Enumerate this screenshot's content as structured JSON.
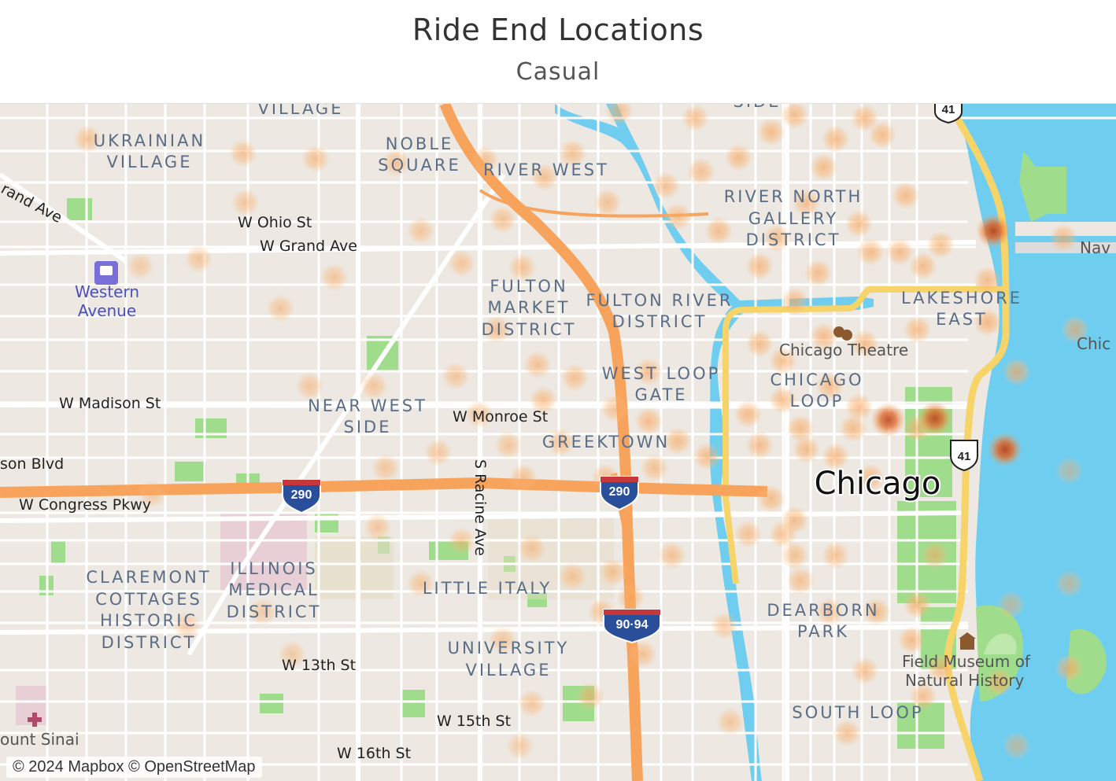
{
  "header": {
    "title": "Ride End Locations",
    "subtitle": "Casual"
  },
  "map": {
    "neighborhoods": [
      {
        "lines": [
          "UKRAINIAN",
          "VILLAGE"
        ]
      },
      {
        "lines": [
          "NOBLE",
          "SQUARE"
        ]
      },
      {
        "lines": [
          "RIVER WEST"
        ]
      },
      {
        "lines": [
          "RIVER NORTH",
          "GALLERY",
          "DISTRICT"
        ]
      },
      {
        "lines": [
          "FULTON",
          "MARKET",
          "DISTRICT"
        ]
      },
      {
        "lines": [
          "FULTON RIVER",
          "DISTRICT"
        ]
      },
      {
        "lines": [
          "LAKESHORE",
          "EAST"
        ]
      },
      {
        "lines": [
          "WEST LOOP",
          "GATE"
        ]
      },
      {
        "lines": [
          "CHICAGO",
          "LOOP"
        ]
      },
      {
        "lines": [
          "NEAR WEST",
          "SIDE"
        ]
      },
      {
        "lines": [
          "GREEKTOWN"
        ]
      },
      {
        "lines": [
          "CLAREMONT",
          "COTTAGES",
          "HISTORIC",
          "DISTRICT"
        ]
      },
      {
        "lines": [
          "ILLINOIS",
          "MEDICAL",
          "DISTRICT"
        ]
      },
      {
        "lines": [
          "LITTLE ITALY"
        ]
      },
      {
        "lines": [
          "DEARBORN",
          "PARK"
        ]
      },
      {
        "lines": [
          "UNIVERSITY",
          "VILLAGE"
        ]
      },
      {
        "lines": [
          "SOUTH LOOP"
        ]
      },
      {
        "lines": [
          "VILLAGE"
        ]
      },
      {
        "lines": [
          "SIDE"
        ]
      }
    ],
    "streets": [
      "W Ohio St",
      "W Grand Ave",
      "W Madison St",
      "W Monroe St",
      "W Congress Pkwy",
      "S Racine Ave",
      "W 13th St",
      "W 15th St",
      "W 16th St",
      "rand Ave",
      "son Blvd"
    ],
    "pois": [
      "Western",
      "Avenue",
      "Chicago Theatre",
      "Field Museum of",
      "Natural History",
      "ount Sinai",
      "Nav",
      "Chic"
    ],
    "city_label": "Chicago",
    "shields": [
      "290",
      "290",
      "90·94",
      "41",
      "41"
    ],
    "attribution": "© 2024 Mapbox © OpenStreetMap",
    "colors": {
      "water": "#6fcdf0",
      "land": "#ede8e2",
      "park": "#9fdc8c",
      "highway": "#f7a35c",
      "primary": "#f7d46a",
      "hotspot": "#f9a55c",
      "hotspot_hot": "#b8471f",
      "label": "#5a6d86"
    },
    "heatmap_points": [
      {
        "lat": 41.8995,
        "lon": -87.6875,
        "w": 0.5
      },
      {
        "lat": 41.8985,
        "lon": -87.6742,
        "w": 0.5
      },
      {
        "lat": 41.8981,
        "lon": -87.668,
        "w": 0.5
      },
      {
        "lat": 41.8978,
        "lon": -87.6611,
        "w": 0.5
      },
      {
        "lat": 41.898,
        "lon": -87.6535,
        "w": 0.5
      },
      {
        "lat": 41.8968,
        "lon": -87.6484,
        "w": 0.5
      },
      {
        "lat": 41.8938,
        "lon": -87.652,
        "w": 0.5
      },
      {
        "lat": 41.893,
        "lon": -87.659,
        "w": 0.4
      },
      {
        "lat": 41.8897,
        "lon": -87.6664,
        "w": 0.4
      },
      {
        "lat": 41.8907,
        "lon": -87.6555,
        "w": 0.4
      },
      {
        "lat": 41.8904,
        "lon": -87.6503,
        "w": 0.5
      },
      {
        "lat": 41.886,
        "lon": -87.6525,
        "w": 0.5
      },
      {
        "lat": 41.8827,
        "lon": -87.656,
        "w": 0.4
      },
      {
        "lat": 41.8835,
        "lon": -87.649,
        "w": 0.5
      },
      {
        "lat": 41.881,
        "lon": -87.6485,
        "w": 0.5
      },
      {
        "lat": 41.8826,
        "lon": -87.6458,
        "w": 0.5
      },
      {
        "lat": 41.88,
        "lon": -87.654,
        "w": 0.4
      },
      {
        "lat": 41.8778,
        "lon": -87.6515,
        "w": 0.4
      },
      {
        "lat": 41.8755,
        "lon": -87.6502,
        "w": 0.5
      },
      {
        "lat": 41.8755,
        "lon": -87.6432,
        "w": 0.5
      },
      {
        "lat": 41.878,
        "lon": -87.647,
        "w": 0.5
      },
      {
        "lat": 41.8804,
        "lon": -87.6424,
        "w": 0.5
      },
      {
        "lat": 41.883,
        "lon": -87.6395,
        "w": 0.6
      },
      {
        "lat": 41.8781,
        "lon": -87.637,
        "w": 0.6
      },
      {
        "lat": 41.8795,
        "lon": -87.6395,
        "w": 0.6
      },
      {
        "lat": 41.8762,
        "lon": -87.639,
        "w": 0.5
      },
      {
        "lat": 41.877,
        "lon": -87.6345,
        "w": 0.6
      },
      {
        "lat": 41.88,
        "lon": -87.631,
        "w": 0.6
      },
      {
        "lat": 41.881,
        "lon": -87.628,
        "w": 0.6
      },
      {
        "lat": 41.885,
        "lon": -87.63,
        "w": 0.6
      },
      {
        "lat": 41.888,
        "lon": -87.627,
        "w": 0.6
      },
      {
        "lat": 41.89,
        "lon": -87.625,
        "w": 0.6
      },
      {
        "lat": 41.8905,
        "lon": -87.63,
        "w": 0.6
      },
      {
        "lat": 41.8925,
        "lon": -87.6285,
        "w": 0.6
      },
      {
        "lat": 41.893,
        "lon": -87.6335,
        "w": 0.6
      },
      {
        "lat": 41.895,
        "lon": -87.626,
        "w": 0.6
      },
      {
        "lat": 41.8975,
        "lon": -87.6245,
        "w": 0.6
      },
      {
        "lat": 41.8982,
        "lon": -87.6318,
        "w": 0.6
      },
      {
        "lat": 41.9,
        "lon": -87.629,
        "w": 0.6
      },
      {
        "lat": 41.9012,
        "lon": -87.627,
        "w": 0.6
      },
      {
        "lat": 41.8995,
        "lon": -87.6235,
        "w": 0.6
      },
      {
        "lat": 41.8998,
        "lon": -87.6195,
        "w": 0.6
      },
      {
        "lat": 41.901,
        "lon": -87.621,
        "w": 0.6
      },
      {
        "lat": 41.8955,
        "lon": -87.6175,
        "w": 0.6
      },
      {
        "lat": 41.8935,
        "lon": -87.6215,
        "w": 0.6
      },
      {
        "lat": 41.8915,
        "lon": -87.6205,
        "w": 0.6
      },
      {
        "lat": 41.8905,
        "lon": -87.616,
        "w": 0.6
      },
      {
        "lat": 41.892,
        "lon": -87.6145,
        "w": 0.6
      },
      {
        "lat": 41.8915,
        "lon": -87.618,
        "w": 0.6
      },
      {
        "lat": 41.893,
        "lon": -87.61,
        "w": 0.9
      },
      {
        "lat": 41.8895,
        "lon": -87.6105,
        "w": 0.6
      },
      {
        "lat": 41.8865,
        "lon": -87.6105,
        "w": 0.7
      },
      {
        "lat": 41.886,
        "lon": -87.6165,
        "w": 0.6
      },
      {
        "lat": 41.885,
        "lon": -87.621,
        "w": 0.6
      },
      {
        "lat": 41.8855,
        "lon": -87.6245,
        "w": 0.6
      },
      {
        "lat": 41.8838,
        "lon": -87.628,
        "w": 0.6
      },
      {
        "lat": 41.882,
        "lon": -87.624,
        "w": 0.6
      },
      {
        "lat": 41.8805,
        "lon": -87.6215,
        "w": 0.6
      },
      {
        "lat": 41.879,
        "lon": -87.622,
        "w": 0.6
      },
      {
        "lat": 41.879,
        "lon": -87.6265,
        "w": 0.6
      },
      {
        "lat": 41.8778,
        "lon": -87.63,
        "w": 0.6
      },
      {
        "lat": 41.8775,
        "lon": -87.626,
        "w": 0.6
      },
      {
        "lat": 41.877,
        "lon": -87.6235,
        "w": 0.6
      },
      {
        "lat": 41.879,
        "lon": -87.6165,
        "w": 0.6
      },
      {
        "lat": 41.8796,
        "lon": -87.619,
        "w": 0.8
      },
      {
        "lat": 41.8797,
        "lon": -87.615,
        "w": 0.8
      },
      {
        "lat": 41.8755,
        "lon": -87.6205,
        "w": 0.6
      },
      {
        "lat": 41.874,
        "lon": -87.629,
        "w": 0.6
      },
      {
        "lat": 41.8725,
        "lon": -87.627,
        "w": 0.6
      },
      {
        "lat": 41.8715,
        "lon": -87.631,
        "w": 0.5
      },
      {
        "lat": 41.8715,
        "lon": -87.628,
        "w": 0.5
      },
      {
        "lat": 41.87,
        "lon": -87.627,
        "w": 0.5
      },
      {
        "lat": 41.87,
        "lon": -87.6235,
        "w": 0.5
      },
      {
        "lat": 41.8682,
        "lon": -87.6265,
        "w": 0.5
      },
      {
        "lat": 41.866,
        "lon": -87.624,
        "w": 0.5
      },
      {
        "lat": 41.866,
        "lon": -87.62,
        "w": 0.6
      },
      {
        "lat": 41.8665,
        "lon": -87.6165,
        "w": 0.7
      },
      {
        "lat": 41.864,
        "lon": -87.617,
        "w": 0.6
      },
      {
        "lat": 41.8618,
        "lon": -87.621,
        "w": 0.5
      },
      {
        "lat": 41.86,
        "lon": -87.616,
        "w": 0.5
      },
      {
        "lat": 41.8574,
        "lon": -87.6225,
        "w": 0.5
      },
      {
        "lat": 41.87,
        "lon": -87.6375,
        "w": 0.5
      },
      {
        "lat": 41.8688,
        "lon": -87.6425,
        "w": 0.5
      },
      {
        "lat": 41.867,
        "lon": -87.641,
        "w": 0.5
      },
      {
        "lat": 41.866,
        "lon": -87.6435,
        "w": 0.5
      },
      {
        "lat": 41.863,
        "lon": -87.64,
        "w": 0.5
      },
      {
        "lat": 41.86,
        "lon": -87.6445,
        "w": 0.5
      },
      {
        "lat": 41.8705,
        "lon": -87.6495,
        "w": 0.4
      },
      {
        "lat": 41.871,
        "lon": -87.6555,
        "w": 0.4
      },
      {
        "lat": 41.868,
        "lon": -87.659,
        "w": 0.4
      },
      {
        "lat": 41.872,
        "lon": -87.6627,
        "w": 0.4
      },
      {
        "lat": 41.8762,
        "lon": -87.662,
        "w": 0.4
      },
      {
        "lat": 41.8773,
        "lon": -87.6575,
        "w": 0.4
      },
      {
        "lat": 41.891,
        "lon": -87.678,
        "w": 0.4
      },
      {
        "lat": 41.8875,
        "lon": -87.671,
        "w": 0.4
      },
      {
        "lat": 41.882,
        "lon": -87.6685,
        "w": 0.4
      },
      {
        "lat": 41.882,
        "lon": -87.663,
        "w": 0.4
      },
      {
        "lat": 41.8743,
        "lon": -87.682,
        "w": 0.3
      },
      {
        "lat": 41.865,
        "lon": -87.679,
        "w": 0.3
      },
      {
        "lat": 41.866,
        "lon": -87.6725,
        "w": 0.3
      },
      {
        "lat": 41.863,
        "lon": -87.67,
        "w": 0.3
      },
      {
        "lat": 41.895,
        "lon": -87.674,
        "w": 0.4
      },
      {
        "lat": 41.8905,
        "lon": -87.683,
        "w": 0.3
      },
      {
        "lat": 41.864,
        "lon": -87.652,
        "w": 0.4
      },
      {
        "lat": 41.8595,
        "lon": -87.6495,
        "w": 0.4
      },
      {
        "lat": 41.8565,
        "lon": -87.6505,
        "w": 0.3
      },
      {
        "lat": 41.8685,
        "lon": -87.646,
        "w": 0.4
      },
      {
        "lat": 41.865,
        "lon": -87.633,
        "w": 0.4
      },
      {
        "lat": 41.8582,
        "lon": -87.6325,
        "w": 0.4
      },
      {
        "lat": 41.87,
        "lon": -87.615,
        "w": 0.5
      },
      {
        "lat": 41.861,
        "lon": -87.6095,
        "w": 0.7
      },
      {
        "lat": 41.862,
        "lon": -87.6035,
        "w": 0.7
      },
      {
        "lat": 41.8665,
        "lon": -87.6085,
        "w": 0.4
      },
      {
        "lat": 41.862,
        "lon": -87.6145,
        "w": 0.6
      },
      {
        "lat": 41.8565,
        "lon": -87.608,
        "w": 0.4
      },
      {
        "lat": 41.886,
        "lon": -87.603,
        "w": 0.6
      },
      {
        "lat": 41.8925,
        "lon": -87.604,
        "w": 0.6
      },
      {
        "lat": 41.883,
        "lon": -87.608,
        "w": 0.7
      },
      {
        "lat": 41.8775,
        "lon": -87.609,
        "w": 0.9
      },
      {
        "lat": 41.876,
        "lon": -87.6035,
        "w": 0.3
      },
      {
        "lat": 41.868,
        "lon": -87.6035,
        "w": 0.4
      },
      {
        "lat": 41.9015,
        "lon": -87.642,
        "w": 0.5
      },
      {
        "lat": 41.8985,
        "lon": -87.646,
        "w": 0.5
      },
      {
        "lat": 41.8962,
        "lon": -87.638,
        "w": 0.5
      },
      {
        "lat": 41.8972,
        "lon": -87.635,
        "w": 0.5
      },
      {
        "lat": 41.901,
        "lon": -87.6355,
        "w": 0.5
      },
      {
        "lat": 41.895,
        "lon": -87.643,
        "w": 0.5
      },
      {
        "lat": 41.894,
        "lon": -87.637,
        "w": 0.5
      }
    ]
  }
}
